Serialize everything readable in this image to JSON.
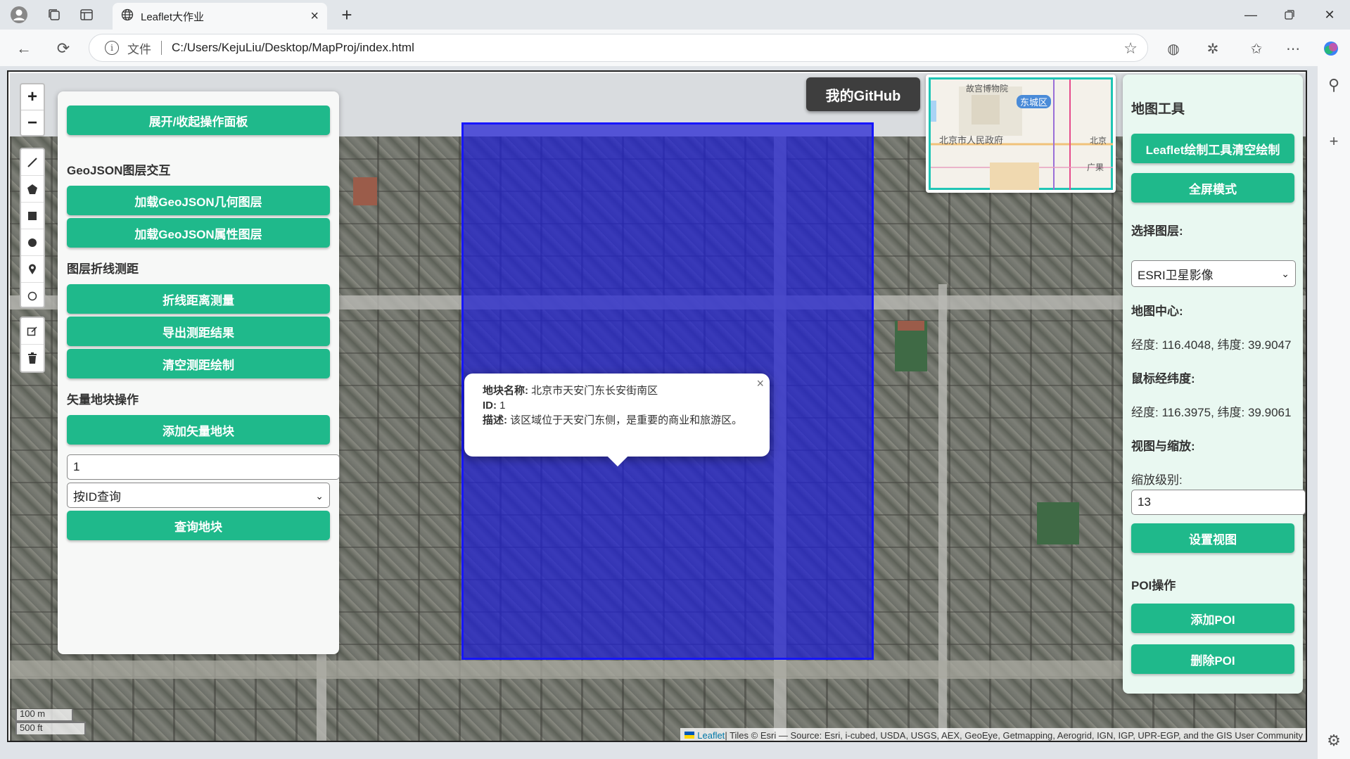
{
  "browser": {
    "tab_title": "Leaflet大作业",
    "url_scheme_label": "文件",
    "url": "C:/Users/KejuLiu/Desktop/MapProj/index.html"
  },
  "map": {
    "zoom_in": "+",
    "zoom_out": "−",
    "scale_metric": "100 m",
    "scale_imperial": "500 ft",
    "attribution_link": "Leaflet",
    "attribution_text": " | Tiles © Esri — Source: Esri, i-cubed, USDA, USGS, AEX, GeoEye, Getmapping, Aerogrid, IGN, IGP, UPR-EGP, and the GIS User Community",
    "polygon_color": "#1f1fd2"
  },
  "popup": {
    "name_label": "地块名称:",
    "name_value": " 北京市天安门东长安街南区",
    "id_label": "ID:",
    "id_value": " 1",
    "desc_label": "描述:",
    "desc_value": " 该区域位于天安门东侧，是重要的商业和旅游区。",
    "close": "×"
  },
  "github_button": "我的GitHub",
  "minimap": {
    "label_palace": "故宫博物院",
    "label_district": "东城区",
    "label_gov": "北京市人民政府",
    "label_beijing": "北京",
    "label_guang": "广果"
  },
  "left_panel": {
    "toggle_button": "展开/收起操作面板",
    "section_geojson": "GeoJSON图层交互",
    "load_geometry_button": "加载GeoJSON几何图层",
    "load_attribute_button": "加载GeoJSON属性图层",
    "section_measure": "图层折线测距",
    "measure_button": "折线距离测量",
    "export_button": "导出测距结果",
    "clear_measure_button": "清空测距绘制",
    "section_parcel": "矢量地块操作",
    "add_parcel_button": "添加矢量地块",
    "query_input_value": "1",
    "query_mode_selected": "按ID查询",
    "query_button": "查询地块"
  },
  "right_panel": {
    "title": "地图工具",
    "clear_draw_button": "Leaflet绘制工具清空绘制",
    "fullscreen_button": "全屏模式",
    "layer_label": "选择图层:",
    "layer_selected": "ESRI卫星影像",
    "center_label": "地图中心:",
    "center_value": "经度: 116.4048, 纬度: 39.9047",
    "mouse_label": "鼠标经纬度:",
    "mouse_value": "经度: 116.3975, 纬度: 39.9061",
    "view_label": "视图与缩放:",
    "zoom_label": "缩放级别:",
    "zoom_value": "13",
    "set_view_button": "设置视图",
    "poi_label": "POI操作",
    "add_poi_button": "添加POI",
    "delete_poi_button": "删除POI"
  },
  "colors": {
    "accent": "#1fb98b",
    "panel_right_bg": "#e9f8f1"
  }
}
